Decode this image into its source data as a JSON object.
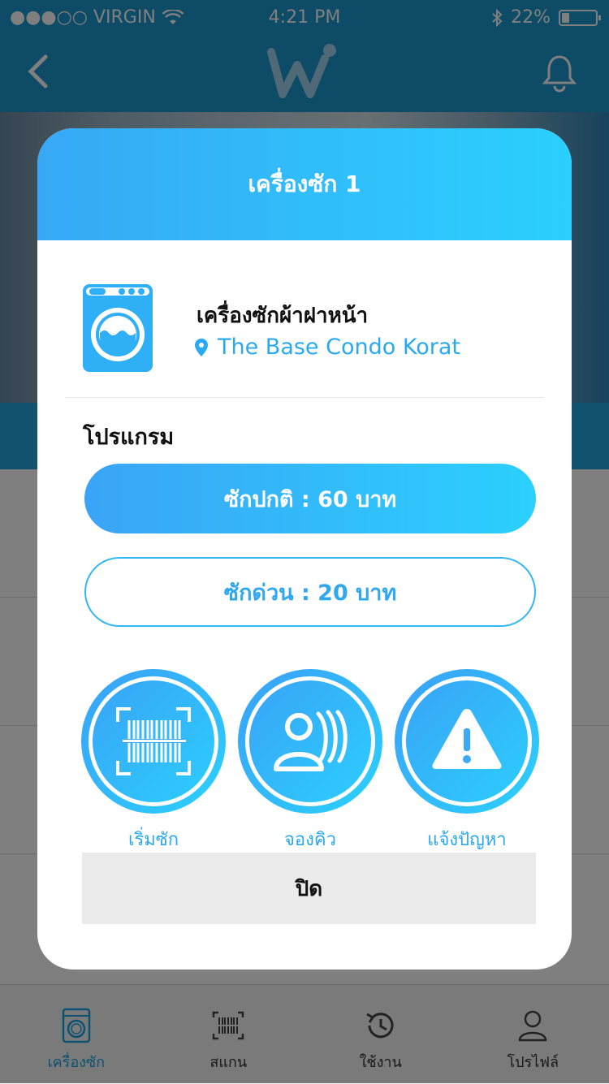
{
  "status_bar": {
    "carrier": "●●●○○ VIRGIN",
    "time": "4:21 PM",
    "battery": "22%",
    "battery_level": 0.22
  },
  "modal": {
    "title": "เครื่องซัก 1",
    "machine_name": "เครื่องซักผ้าฝาหน้า",
    "location": "The Base Condo Korat",
    "program_title": "โปรแกรม",
    "programs": [
      {
        "label": "ซักปกติ : 60 บาท",
        "selected": true
      },
      {
        "label": "ซักด่วน : 20 บาท",
        "selected": false
      }
    ],
    "actions": [
      {
        "label": "เริ่มซัก",
        "icon": "barcode-scan-icon"
      },
      {
        "label": "จองคิว",
        "icon": "queue-people-icon"
      },
      {
        "label": "แจ้งปัญหา",
        "icon": "warning-icon"
      }
    ],
    "close_label": "ปิด"
  },
  "tab_bar": {
    "tabs": [
      {
        "label": "เครื่องซัก",
        "icon": "washing-machine-icon",
        "active": true
      },
      {
        "label": "สแกน",
        "icon": "barcode-icon",
        "active": false
      },
      {
        "label": "ใช้งาน",
        "icon": "history-icon",
        "active": false
      },
      {
        "label": "โปรไฟล์",
        "icon": "profile-icon",
        "active": false
      }
    ]
  },
  "colors": {
    "primary": "#2bb0f2",
    "gradient_start": "#37a8f5",
    "gradient_end": "#2bd0fe",
    "nav_bar": "#1c96cf"
  }
}
